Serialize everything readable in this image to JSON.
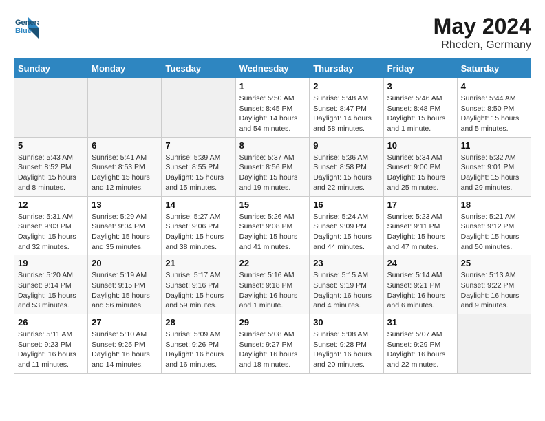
{
  "logo": {
    "line1": "General",
    "line2": "Blue"
  },
  "title": "May 2024",
  "subtitle": "Rheden, Germany",
  "days_header": [
    "Sunday",
    "Monday",
    "Tuesday",
    "Wednesday",
    "Thursday",
    "Friday",
    "Saturday"
  ],
  "weeks": [
    [
      {
        "num": "",
        "info": ""
      },
      {
        "num": "",
        "info": ""
      },
      {
        "num": "",
        "info": ""
      },
      {
        "num": "1",
        "info": "Sunrise: 5:50 AM\nSunset: 8:45 PM\nDaylight: 14 hours\nand 54 minutes."
      },
      {
        "num": "2",
        "info": "Sunrise: 5:48 AM\nSunset: 8:47 PM\nDaylight: 14 hours\nand 58 minutes."
      },
      {
        "num": "3",
        "info": "Sunrise: 5:46 AM\nSunset: 8:48 PM\nDaylight: 15 hours\nand 1 minute."
      },
      {
        "num": "4",
        "info": "Sunrise: 5:44 AM\nSunset: 8:50 PM\nDaylight: 15 hours\nand 5 minutes."
      }
    ],
    [
      {
        "num": "5",
        "info": "Sunrise: 5:43 AM\nSunset: 8:52 PM\nDaylight: 15 hours\nand 8 minutes."
      },
      {
        "num": "6",
        "info": "Sunrise: 5:41 AM\nSunset: 8:53 PM\nDaylight: 15 hours\nand 12 minutes."
      },
      {
        "num": "7",
        "info": "Sunrise: 5:39 AM\nSunset: 8:55 PM\nDaylight: 15 hours\nand 15 minutes."
      },
      {
        "num": "8",
        "info": "Sunrise: 5:37 AM\nSunset: 8:56 PM\nDaylight: 15 hours\nand 19 minutes."
      },
      {
        "num": "9",
        "info": "Sunrise: 5:36 AM\nSunset: 8:58 PM\nDaylight: 15 hours\nand 22 minutes."
      },
      {
        "num": "10",
        "info": "Sunrise: 5:34 AM\nSunset: 9:00 PM\nDaylight: 15 hours\nand 25 minutes."
      },
      {
        "num": "11",
        "info": "Sunrise: 5:32 AM\nSunset: 9:01 PM\nDaylight: 15 hours\nand 29 minutes."
      }
    ],
    [
      {
        "num": "12",
        "info": "Sunrise: 5:31 AM\nSunset: 9:03 PM\nDaylight: 15 hours\nand 32 minutes."
      },
      {
        "num": "13",
        "info": "Sunrise: 5:29 AM\nSunset: 9:04 PM\nDaylight: 15 hours\nand 35 minutes."
      },
      {
        "num": "14",
        "info": "Sunrise: 5:27 AM\nSunset: 9:06 PM\nDaylight: 15 hours\nand 38 minutes."
      },
      {
        "num": "15",
        "info": "Sunrise: 5:26 AM\nSunset: 9:08 PM\nDaylight: 15 hours\nand 41 minutes."
      },
      {
        "num": "16",
        "info": "Sunrise: 5:24 AM\nSunset: 9:09 PM\nDaylight: 15 hours\nand 44 minutes."
      },
      {
        "num": "17",
        "info": "Sunrise: 5:23 AM\nSunset: 9:11 PM\nDaylight: 15 hours\nand 47 minutes."
      },
      {
        "num": "18",
        "info": "Sunrise: 5:21 AM\nSunset: 9:12 PM\nDaylight: 15 hours\nand 50 minutes."
      }
    ],
    [
      {
        "num": "19",
        "info": "Sunrise: 5:20 AM\nSunset: 9:14 PM\nDaylight: 15 hours\nand 53 minutes."
      },
      {
        "num": "20",
        "info": "Sunrise: 5:19 AM\nSunset: 9:15 PM\nDaylight: 15 hours\nand 56 minutes."
      },
      {
        "num": "21",
        "info": "Sunrise: 5:17 AM\nSunset: 9:16 PM\nDaylight: 15 hours\nand 59 minutes."
      },
      {
        "num": "22",
        "info": "Sunrise: 5:16 AM\nSunset: 9:18 PM\nDaylight: 16 hours\nand 1 minute."
      },
      {
        "num": "23",
        "info": "Sunrise: 5:15 AM\nSunset: 9:19 PM\nDaylight: 16 hours\nand 4 minutes."
      },
      {
        "num": "24",
        "info": "Sunrise: 5:14 AM\nSunset: 9:21 PM\nDaylight: 16 hours\nand 6 minutes."
      },
      {
        "num": "25",
        "info": "Sunrise: 5:13 AM\nSunset: 9:22 PM\nDaylight: 16 hours\nand 9 minutes."
      }
    ],
    [
      {
        "num": "26",
        "info": "Sunrise: 5:11 AM\nSunset: 9:23 PM\nDaylight: 16 hours\nand 11 minutes."
      },
      {
        "num": "27",
        "info": "Sunrise: 5:10 AM\nSunset: 9:25 PM\nDaylight: 16 hours\nand 14 minutes."
      },
      {
        "num": "28",
        "info": "Sunrise: 5:09 AM\nSunset: 9:26 PM\nDaylight: 16 hours\nand 16 minutes."
      },
      {
        "num": "29",
        "info": "Sunrise: 5:08 AM\nSunset: 9:27 PM\nDaylight: 16 hours\nand 18 minutes."
      },
      {
        "num": "30",
        "info": "Sunrise: 5:08 AM\nSunset: 9:28 PM\nDaylight: 16 hours\nand 20 minutes."
      },
      {
        "num": "31",
        "info": "Sunrise: 5:07 AM\nSunset: 9:29 PM\nDaylight: 16 hours\nand 22 minutes."
      },
      {
        "num": "",
        "info": ""
      }
    ]
  ]
}
